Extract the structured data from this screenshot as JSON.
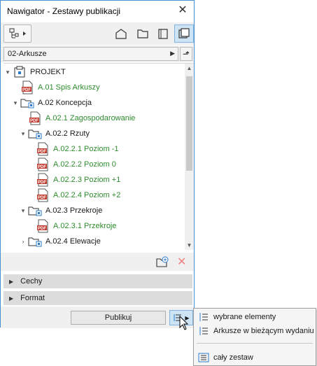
{
  "window": {
    "title": "Nawigator - Zestawy publikacji"
  },
  "publisher_set": {
    "selected": "02-Arkusze"
  },
  "tree": [
    {
      "label": "PROJEKT",
      "level": 0,
      "type": "project",
      "toggle": "expanded"
    },
    {
      "label": "A.01 Spis Arkuszy",
      "level": 1,
      "type": "pdf",
      "toggle": "none"
    },
    {
      "label": "A.02 Koncepcja",
      "level": 1,
      "type": "folder",
      "toggle": "expanded"
    },
    {
      "label": "A.02.1 Zagospodarowanie",
      "level": 2,
      "type": "pdf",
      "toggle": "none"
    },
    {
      "label": "A.02.2 Rzuty",
      "level": 2,
      "type": "folder",
      "toggle": "expanded"
    },
    {
      "label": "A.02.2.1 Poziom -1",
      "level": 3,
      "type": "pdf",
      "toggle": "none"
    },
    {
      "label": "A.02.2.2 Poziom 0",
      "level": 3,
      "type": "pdf",
      "toggle": "none"
    },
    {
      "label": "A.02.2.3 Poziom +1",
      "level": 3,
      "type": "pdf",
      "toggle": "none"
    },
    {
      "label": "A.02.2.4 Poziom +2",
      "level": 3,
      "type": "pdf",
      "toggle": "none"
    },
    {
      "label": "A.02.3 Przekroje",
      "level": 2,
      "type": "folder",
      "toggle": "expanded"
    },
    {
      "label": "A.02.3.1 Przekroje",
      "level": 3,
      "type": "pdf",
      "toggle": "none"
    },
    {
      "label": "A.02.4 Elewacje",
      "level": 2,
      "type": "folder",
      "toggle": "collapsed"
    }
  ],
  "panels": {
    "properties": "Cechy",
    "format": "Format"
  },
  "publish_button": "Publikuj",
  "publish_menu": {
    "selected_elements": "wybrane elementy",
    "current_issue_sheets": "Arkusze w bieżącym wydaniu",
    "whole_set": "cały zestaw"
  },
  "colors": {
    "pdf_text": "#2e8b2e",
    "pdf_icon": "#c0392b",
    "active": "#cde4f7"
  },
  "icons": {
    "toolbar": [
      "tree-options-icon",
      "project-map-icon",
      "view-map-icon",
      "layout-book-icon",
      "publisher-sets-icon"
    ],
    "actions": [
      "new-folder-icon",
      "delete-icon"
    ]
  }
}
